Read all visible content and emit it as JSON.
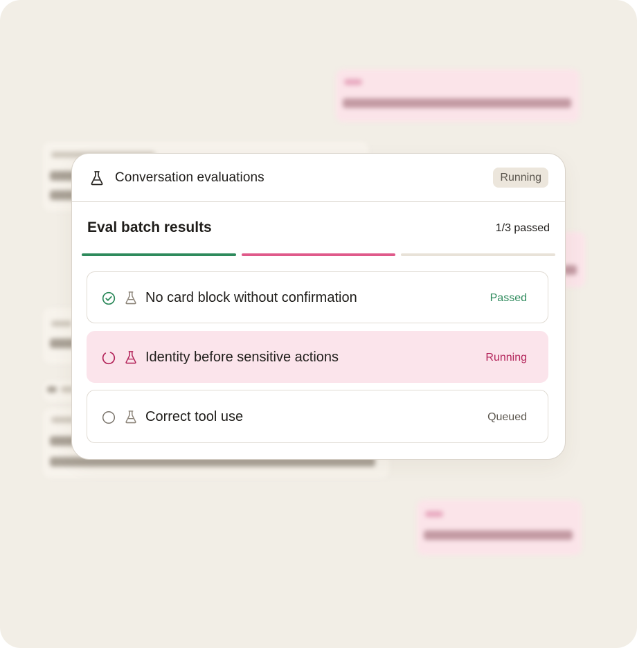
{
  "card": {
    "header_title": "Conversation evaluations",
    "header_status": "Running",
    "header_icon": "flask-icon"
  },
  "batch": {
    "title": "Eval batch results",
    "summary": "1/3 passed",
    "progress_segments": [
      {
        "state": "passed",
        "color": "#2e8a5c"
      },
      {
        "state": "running",
        "color": "#df5a8a"
      },
      {
        "state": "queued",
        "color": "#e8e2d8"
      }
    ]
  },
  "evaluations": [
    {
      "name": "No card block without confirmation",
      "status": "Passed",
      "status_icon": "check-circle-icon",
      "status_color": "#2e8a5c"
    },
    {
      "name": "Identity before sensitive actions",
      "status": "Running",
      "status_icon": "spinner-icon",
      "status_color": "#b3245a"
    },
    {
      "name": "Correct tool use",
      "status": "Queued",
      "status_icon": "empty-circle-icon",
      "status_color": "#5c574f"
    }
  ],
  "colors": {
    "page_bg": "#f2eee6",
    "card_bg": "#ffffff",
    "passed": "#2e8a5c",
    "running": "#b3245a",
    "running_row_bg": "#fbe4eb",
    "queued": "#5c574f"
  }
}
